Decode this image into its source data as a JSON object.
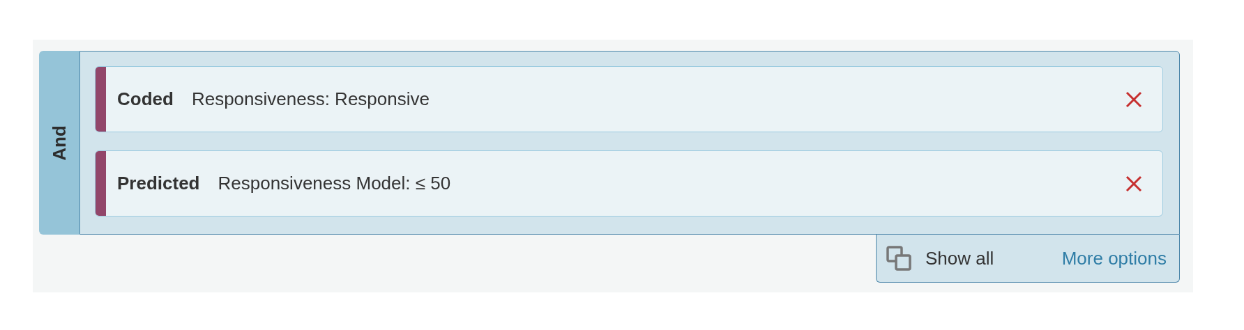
{
  "group": {
    "operator": "And",
    "filters": [
      {
        "kind": "Coded",
        "description": "Responsiveness: Responsive",
        "color": "#92466a"
      },
      {
        "kind": "Predicted",
        "description": "Responsiveness Model: ≤ 50",
        "color": "#92466a"
      }
    ]
  },
  "footer": {
    "show_all": "Show all",
    "more_options": "More options"
  }
}
